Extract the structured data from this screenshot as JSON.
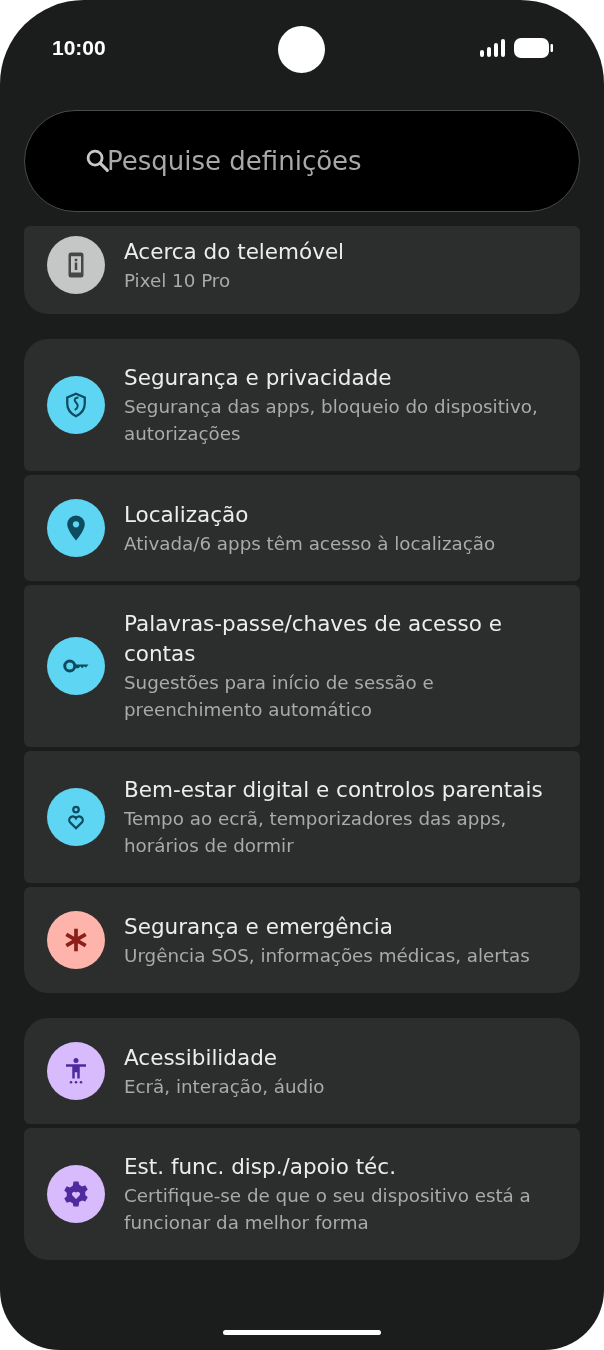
{
  "status_bar": {
    "time": "10:00"
  },
  "search": {
    "placeholder": "Pesquise definições"
  },
  "groups": [
    {
      "items": [
        {
          "kind": "device-info",
          "color": "#c4c7c5",
          "title": "Acerca do telemóvel",
          "subtitle": "Pixel 10 Pro"
        }
      ]
    },
    {
      "items": [
        {
          "kind": "shield",
          "color": "#5fd5f4",
          "title": "Segurança e privacidade",
          "subtitle": "Segurança das apps, bloqueio do dispositivo, autorizações"
        },
        {
          "kind": "location",
          "color": "#5fd5f4",
          "title": "Localização",
          "subtitle": "Ativada/6 apps têm acesso à localização"
        },
        {
          "kind": "key",
          "color": "#5fd5f4",
          "title": "Palavras-passe/chaves de acesso e contas",
          "subtitle": "Sugestões para início de sessão e preenchimento automático"
        },
        {
          "kind": "wellbeing",
          "color": "#5fd5f4",
          "title": "Bem-estar digital e controlos parentais",
          "subtitle": "Tempo ao ecrã, temporizadores das apps, horários de dormir"
        },
        {
          "kind": "emergency",
          "color": "#ffb4ab",
          "title": "Segurança e emergência",
          "subtitle": "Urgência SOS, informações médicas, alertas"
        }
      ]
    },
    {
      "items": [
        {
          "kind": "accessibility",
          "color": "#d8bbfc",
          "title": "Acessibilidade",
          "subtitle": "Ecrã, interação, áudio"
        },
        {
          "kind": "support",
          "color": "#d8bbfc",
          "title": "Est. func. disp./apoio téc.",
          "subtitle": "Certifique-se de que o seu dispositivo está a funcionar da melhor forma"
        }
      ]
    }
  ]
}
